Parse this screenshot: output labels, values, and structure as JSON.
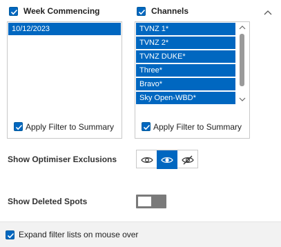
{
  "week_commencing": {
    "header_label": "Week Commencing",
    "header_checked": true,
    "items": [
      {
        "label": "10/12/2023",
        "selected": true
      }
    ],
    "apply_filter_label": "Apply Filter to Summary",
    "apply_filter_checked": true
  },
  "channels": {
    "header_label": "Channels",
    "header_checked": true,
    "items": [
      {
        "label": "TVNZ 1*",
        "selected": true
      },
      {
        "label": "TVNZ 2*",
        "selected": true
      },
      {
        "label": "TVNZ DUKE*",
        "selected": true
      },
      {
        "label": "Three*",
        "selected": true
      },
      {
        "label": "Bravo*",
        "selected": true
      },
      {
        "label": "Sky Open-WBD*",
        "selected": true
      }
    ],
    "apply_filter_label": "Apply Filter to Summary",
    "apply_filter_checked": true
  },
  "optimiser_exclusions": {
    "label": "Show Optimiser Exclusions",
    "options": [
      "eye-icon",
      "eye-filled-icon",
      "eye-off-icon"
    ],
    "active_index": 1
  },
  "deleted_spots": {
    "label": "Show Deleted Spots",
    "toggle_on": false
  },
  "footer": {
    "expand_label": "Expand filter lists on mouse over",
    "expand_checked": true
  },
  "colors": {
    "accent": "#0067c0",
    "toggle_off": "#7a7a7a"
  }
}
